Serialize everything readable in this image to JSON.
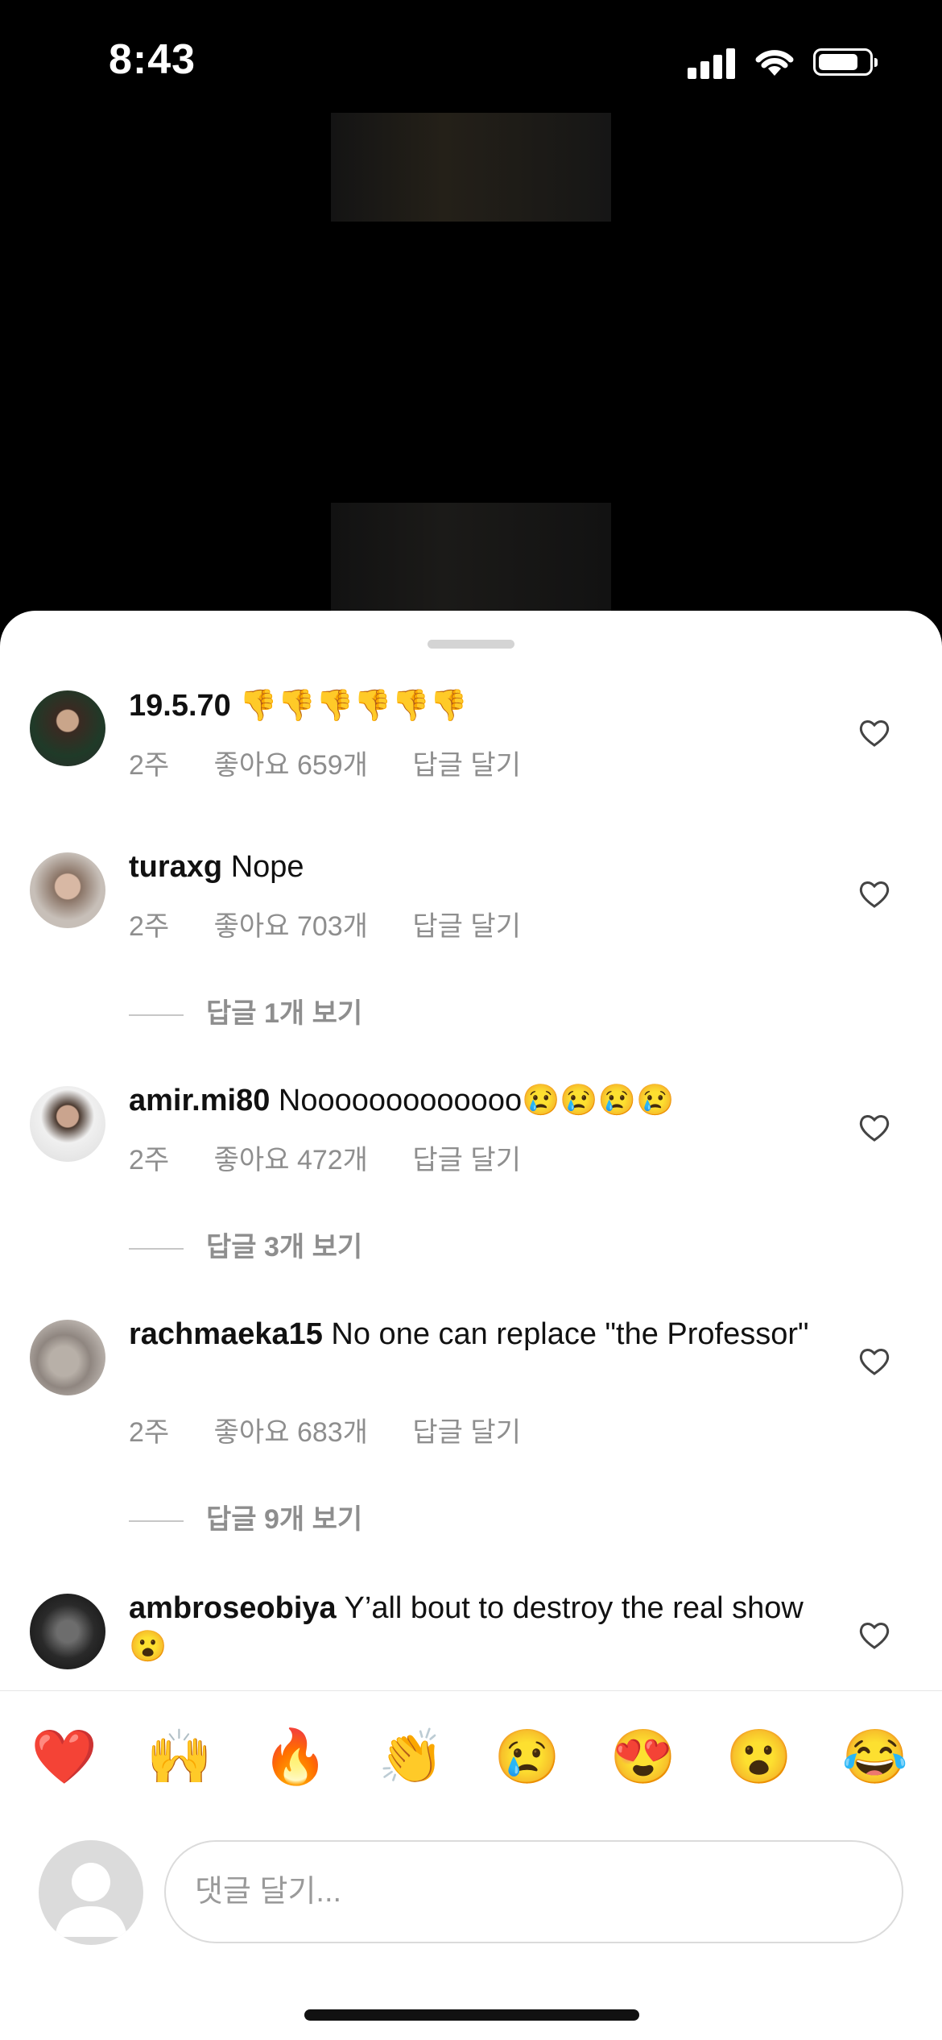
{
  "status_bar": {
    "time": "8:43"
  },
  "comments": [
    {
      "username": "",
      "text": "19.5.70 👎👎👎👎👎👎",
      "time": "2주",
      "likes": "좋아요 659개",
      "reply_label": "답글 달기",
      "view_replies": ""
    },
    {
      "username": "turaxg",
      "text": "Nope",
      "time": "2주",
      "likes": "좋아요 703개",
      "reply_label": "답글 달기",
      "view_replies": "답글 1개 보기"
    },
    {
      "username": "amir.mi80",
      "text": "Nooooooooooooo😢😢😢😢",
      "time": "2주",
      "likes": "좋아요 472개",
      "reply_label": "답글 달기",
      "view_replies": "답글 3개 보기"
    },
    {
      "username": "rachmaeka15",
      "text": "No one can replace \"the Professor\"",
      "time": "2주",
      "likes": "좋아요 683개",
      "reply_label": "답글 달기",
      "view_replies": "답글 9개 보기"
    },
    {
      "username": "ambroseobiya",
      "text": "Y’all bout to destroy the real show 😮",
      "time": "",
      "likes": "",
      "reply_label": "",
      "view_replies": ""
    }
  ],
  "quick_emojis": [
    "❤️",
    "🙌",
    "🔥",
    "👏",
    "😢",
    "😍",
    "😮",
    "😂"
  ],
  "input": {
    "placeholder": "댓글 달기..."
  }
}
